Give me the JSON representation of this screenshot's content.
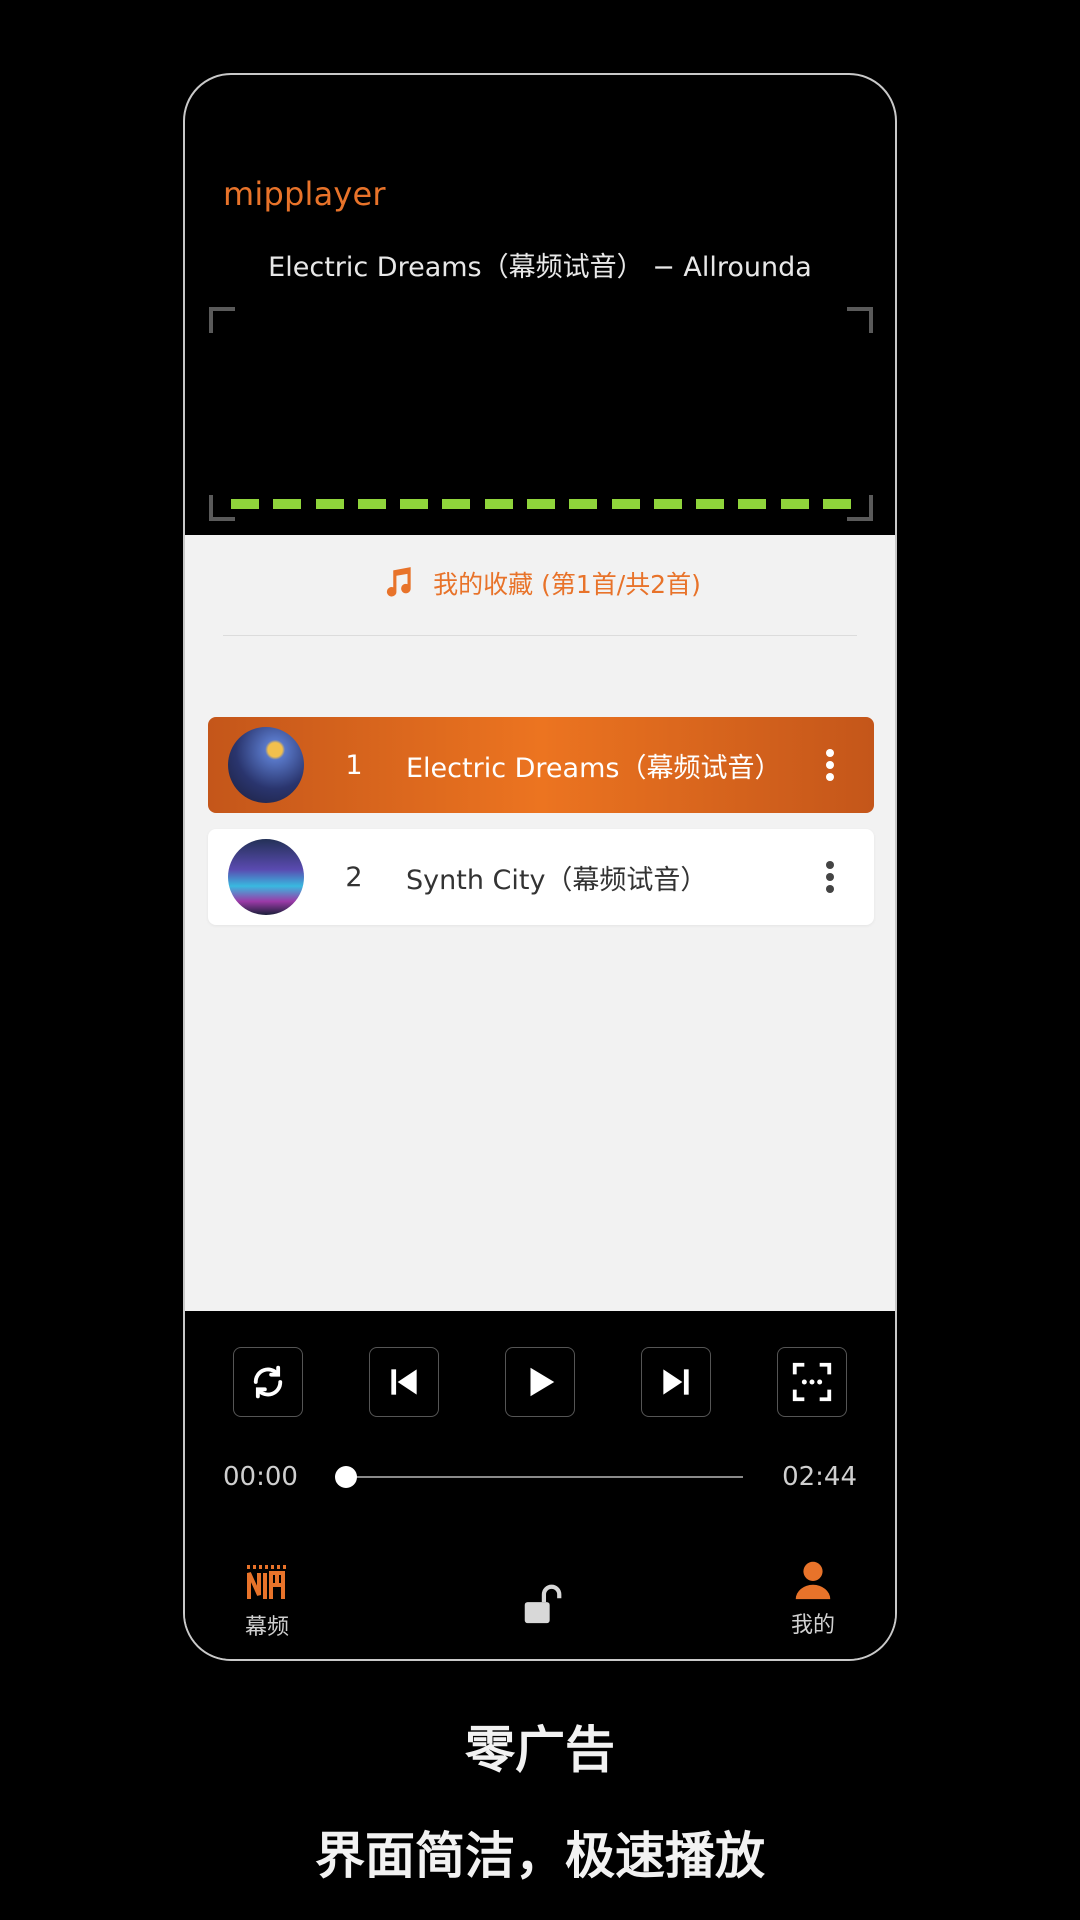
{
  "app": {
    "name": "mipplayer"
  },
  "now_playing": {
    "text": "Electric Dreams（幕频试音） − Allrounda"
  },
  "visualizer": {
    "bar_color": "#8fd43b",
    "segments": 15
  },
  "playlist": {
    "header": "我的收藏 (第1首/共2首)",
    "tracks": [
      {
        "number": "1",
        "title": "Electric Dreams（幕频试音）",
        "active": true
      },
      {
        "number": "2",
        "title": "Synth City（幕频试音）",
        "active": false
      }
    ]
  },
  "controls": {
    "buttons": [
      "repeat-icon",
      "previous-icon",
      "play-icon",
      "next-icon",
      "fullscreen-icon"
    ]
  },
  "progress": {
    "current": "00:00",
    "total": "02:44",
    "fraction": 0
  },
  "nav": {
    "left_label": "幕频",
    "right_label": "我的"
  },
  "captions": {
    "line1": "零广告",
    "line2": "界面简洁，极速播放"
  },
  "colors": {
    "accent": "#e8732a",
    "active_row": "#ec7420",
    "background": "#000000",
    "list_bg": "#f2f2f2"
  }
}
